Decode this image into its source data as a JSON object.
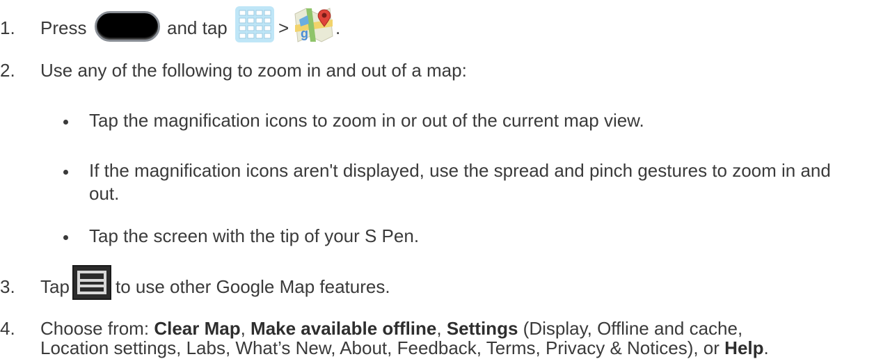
{
  "steps": [
    {
      "number": "1.",
      "parts": {
        "press": "Press",
        "and_tap": "and tap",
        "gt": ">",
        "period": "."
      }
    },
    {
      "number": "2.",
      "text": "Use any of the following to zoom in and out of a map:"
    },
    {
      "number": "3.",
      "parts": {
        "tap": "Tap",
        "rest": "to use other Google Map features."
      }
    },
    {
      "number": "4.",
      "parts": {
        "choose": "Choose from:",
        "clear_map": "Clear Map",
        "sep1": ",",
        "make_offline": "Make available offline",
        "sep2": ",",
        "settings": "Settings",
        "settings_detail_1": "(Display, Offline and cache,",
        "settings_detail_2": "Location settings, Labs, What’s New, About, Feedback, Terms, Privacy & Notices), or",
        "help": "Help",
        "period": "."
      }
    }
  ],
  "bullets": [
    {
      "text": "Tap the magnification icons to zoom in or out of the current map view."
    },
    {
      "line1": "If the magnification icons aren't displayed, use the spread and pinch gestures to zoom in and",
      "line2": "out."
    },
    {
      "text": "Tap the screen with the tip of your S Pen."
    }
  ],
  "icons": {
    "home_key": "home-key-icon",
    "apps": "apps-grid-icon",
    "maps": "google-maps-icon",
    "menu": "menu-key-icon"
  }
}
